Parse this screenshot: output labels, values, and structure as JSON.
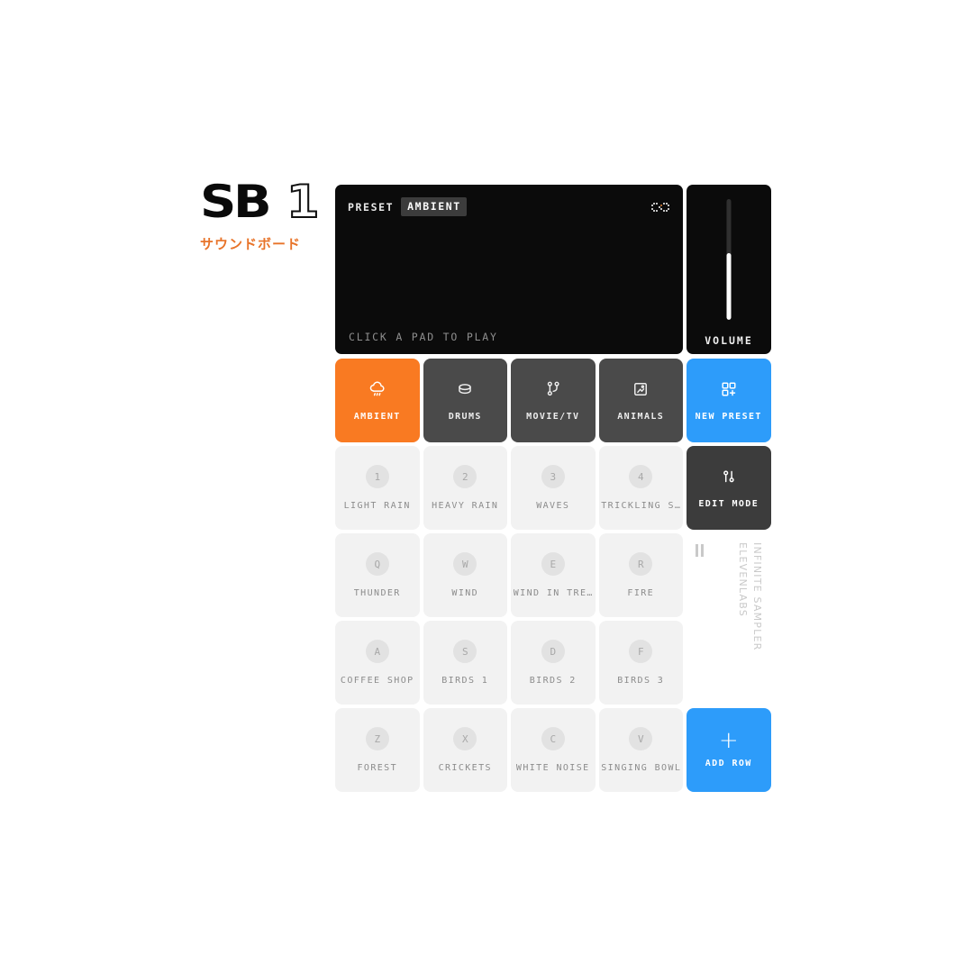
{
  "brand": {
    "logo_main": "SB",
    "logo_accent": "1",
    "subtitle": "サウンドボード",
    "accent_color": "#e8742a"
  },
  "display": {
    "preset_label": "PRESET",
    "preset_value": "AMBIENT",
    "loop_icon": "loop-dotted-icon",
    "hint": "CLICK A PAD TO PLAY"
  },
  "volume": {
    "label": "VOLUME",
    "level_percent": 55
  },
  "tabs": [
    {
      "label": "AMBIENT",
      "icon": "cloud-rain-icon",
      "state": "active"
    },
    {
      "label": "DRUMS",
      "icon": "drum-disc-icon",
      "state": "idle"
    },
    {
      "label": "MOVIE/TV",
      "icon": "git-branch-icon",
      "state": "idle"
    },
    {
      "label": "ANIMALS",
      "icon": "framed-paw-icon",
      "state": "idle"
    },
    {
      "label": "NEW PRESET",
      "icon": "grid-plus-icon",
      "state": "blue"
    }
  ],
  "pad_rows": [
    {
      "pads": [
        {
          "key": "1",
          "label": "LIGHT RAIN"
        },
        {
          "key": "2",
          "label": "HEAVY RAIN"
        },
        {
          "key": "3",
          "label": "WAVES"
        },
        {
          "key": "4",
          "label": "TRICKLING S…"
        }
      ],
      "util": {
        "label": "EDIT MODE",
        "icon": "sliders-icon",
        "style": "dark"
      }
    },
    {
      "pads": [
        {
          "key": "Q",
          "label": "THUNDER"
        },
        {
          "key": "W",
          "label": "WIND"
        },
        {
          "key": "E",
          "label": "WIND IN TRE…"
        },
        {
          "key": "R",
          "label": "FIRE"
        }
      ],
      "util": null
    },
    {
      "pads": [
        {
          "key": "A",
          "label": "COFFEE SHOP"
        },
        {
          "key": "S",
          "label": "BIRDS 1"
        },
        {
          "key": "D",
          "label": "BIRDS 2"
        },
        {
          "key": "F",
          "label": "BIRDS 3"
        }
      ],
      "util": null
    },
    {
      "pads": [
        {
          "key": "Z",
          "label": "FOREST"
        },
        {
          "key": "X",
          "label": "CRICKETS"
        },
        {
          "key": "C",
          "label": "WHITE NOISE"
        },
        {
          "key": "V",
          "label": "SINGING BOWL"
        }
      ],
      "util": {
        "label": "ADD ROW",
        "icon": "plus-icon",
        "style": "blue"
      }
    }
  ],
  "side_meta": {
    "pause_icon": "pause-icon",
    "line_1": "INFINITE SAMPLER",
    "line_2": "ELEVENLABS"
  },
  "colors": {
    "accent_orange": "#f97a22",
    "accent_blue": "#2d9cfa",
    "panel_dark": "#0b0b0b",
    "tab_idle": "#4a4a4a",
    "pad_bg": "#f2f2f2"
  }
}
